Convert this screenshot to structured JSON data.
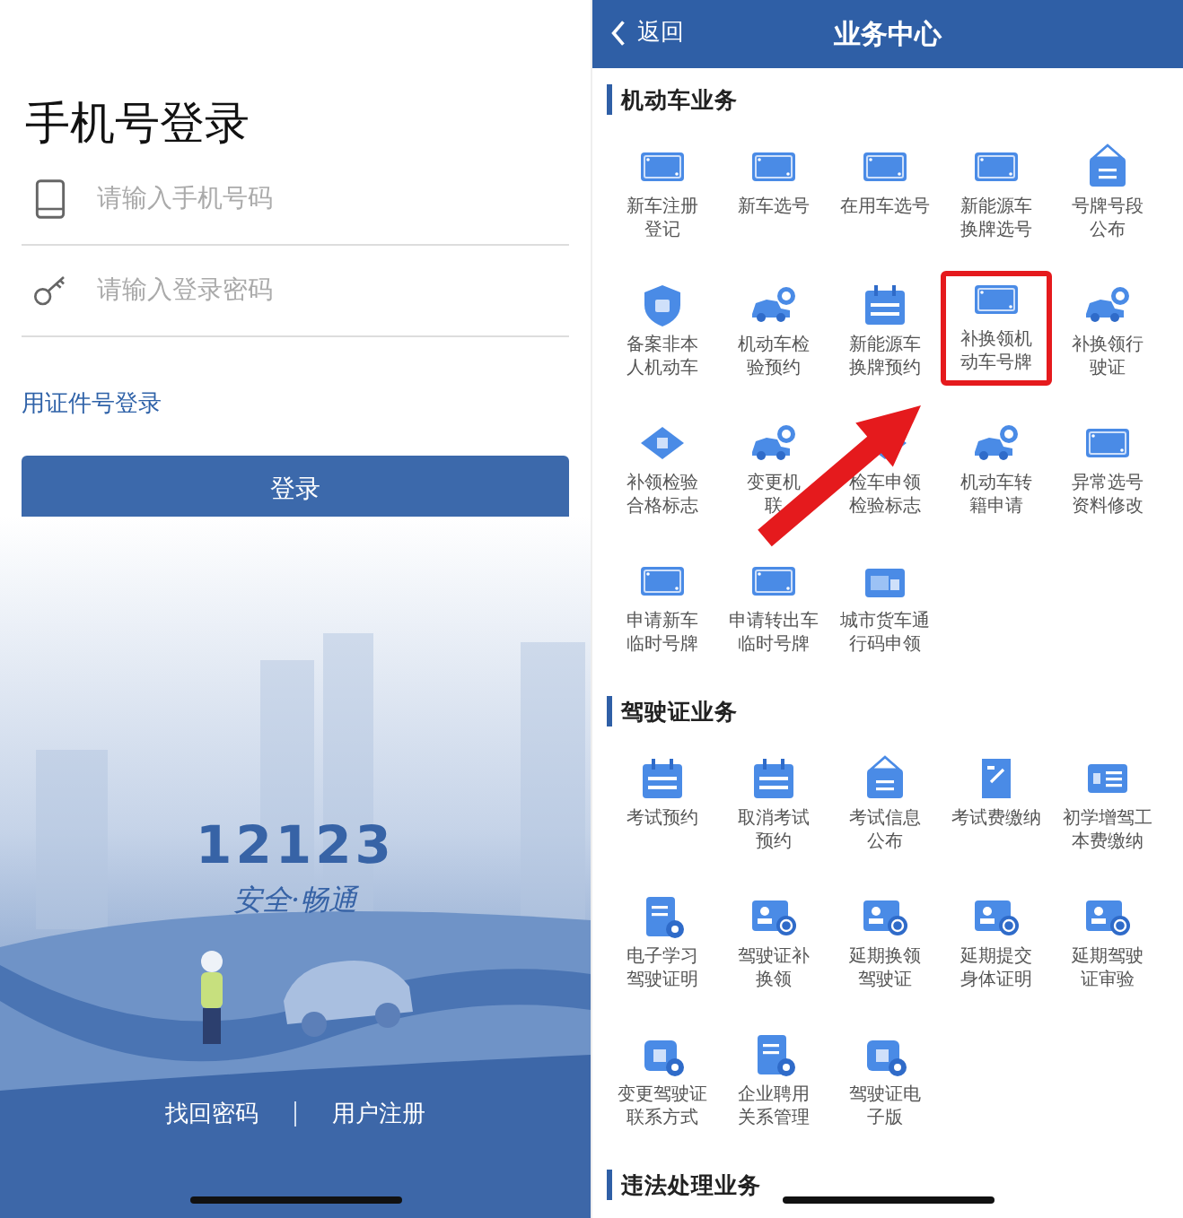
{
  "login": {
    "title": "手机号登录",
    "fields": [
      {
        "kind": "phone",
        "placeholder": "请输入手机号码"
      },
      {
        "kind": "password",
        "placeholder": "请输入登录密码"
      }
    ],
    "id_login_link": "用证件号登录",
    "login_button": "登录",
    "logo_number": "12123",
    "logo_slogan": "安全·畅通",
    "links": [
      "找回密码",
      "用户注册"
    ]
  },
  "services": {
    "back": "返回",
    "title": "业务中心",
    "sections": [
      {
        "title": "机动车业务",
        "items": [
          {
            "kind": "plate",
            "lines": [
              "新车注册",
              "登记"
            ],
            "highlighted": false
          },
          {
            "kind": "plate",
            "lines": [
              "新车选号"
            ],
            "highlighted": false
          },
          {
            "kind": "plate",
            "lines": [
              "在用车选号"
            ],
            "highlighted": false
          },
          {
            "kind": "plate",
            "lines": [
              "新能源车",
              "换牌选号"
            ],
            "highlighted": false
          },
          {
            "kind": "sign",
            "lines": [
              "号牌号段",
              "公布"
            ],
            "highlighted": false
          },
          {
            "kind": "shield",
            "lines": [
              "备案非本",
              "人机动车"
            ],
            "highlighted": false
          },
          {
            "kind": "car",
            "lines": [
              "机动车检",
              "验预约"
            ],
            "highlighted": false
          },
          {
            "kind": "calendar",
            "lines": [
              "新能源车",
              "换牌预约"
            ],
            "highlighted": false
          },
          {
            "kind": "plate",
            "lines": [
              "补换领机",
              "动车号牌"
            ],
            "highlighted": true
          },
          {
            "kind": "car",
            "lines": [
              "补换领行",
              "驶证"
            ],
            "highlighted": false
          },
          {
            "kind": "diamond",
            "lines": [
              "补领检验",
              "合格标志"
            ],
            "highlighted": false
          },
          {
            "kind": "car",
            "lines": [
              "变更机",
              "联"
            ],
            "highlighted": false
          },
          {
            "kind": "diamond",
            "lines": [
              "检车申领",
              "检验标志"
            ],
            "highlighted": false
          },
          {
            "kind": "car",
            "lines": [
              "机动车转",
              "籍申请"
            ],
            "highlighted": false
          },
          {
            "kind": "plate",
            "lines": [
              "异常选号",
              "资料修改"
            ],
            "highlighted": false
          },
          {
            "kind": "plate",
            "lines": [
              "申请新车",
              "临时号牌"
            ],
            "highlighted": false
          },
          {
            "kind": "plate",
            "lines": [
              "申请转出车",
              "临时号牌"
            ],
            "highlighted": false
          },
          {
            "kind": "truck",
            "lines": [
              "城市货车通",
              "行码申领"
            ],
            "highlighted": false
          }
        ]
      },
      {
        "title": "驾驶证业务",
        "items": [
          {
            "kind": "calendar",
            "lines": [
              "考试预约"
            ],
            "highlighted": false
          },
          {
            "kind": "calendar",
            "lines": [
              "取消考试",
              "预约"
            ],
            "highlighted": false
          },
          {
            "kind": "sign",
            "lines": [
              "考试信息",
              "公布"
            ],
            "highlighted": false
          },
          {
            "kind": "receipt",
            "lines": [
              "考试费缴纳"
            ],
            "highlighted": false
          },
          {
            "kind": "card",
            "lines": [
              "初学增驾工",
              "本费缴纳"
            ],
            "highlighted": false
          },
          {
            "kind": "doc",
            "lines": [
              "电子学习",
              "驾驶证明"
            ],
            "highlighted": false
          },
          {
            "kind": "person",
            "lines": [
              "驾驶证补",
              "换领"
            ],
            "highlighted": false
          },
          {
            "kind": "person",
            "lines": [
              "延期换领",
              "驾驶证"
            ],
            "highlighted": false
          },
          {
            "kind": "person",
            "lines": [
              "延期提交",
              "身体证明"
            ],
            "highlighted": false
          },
          {
            "kind": "person",
            "lines": [
              "延期驾驶",
              "证审验"
            ],
            "highlighted": false
          },
          {
            "kind": "wallet",
            "lines": [
              "变更驾驶证",
              "联系方式"
            ],
            "highlighted": false
          },
          {
            "kind": "doc",
            "lines": [
              "企业聘用",
              "关系管理"
            ],
            "highlighted": false
          },
          {
            "kind": "wallet",
            "lines": [
              "驾驶证电",
              "子版"
            ],
            "highlighted": false
          }
        ]
      },
      {
        "title": "违法处理业务"
      }
    ]
  }
}
